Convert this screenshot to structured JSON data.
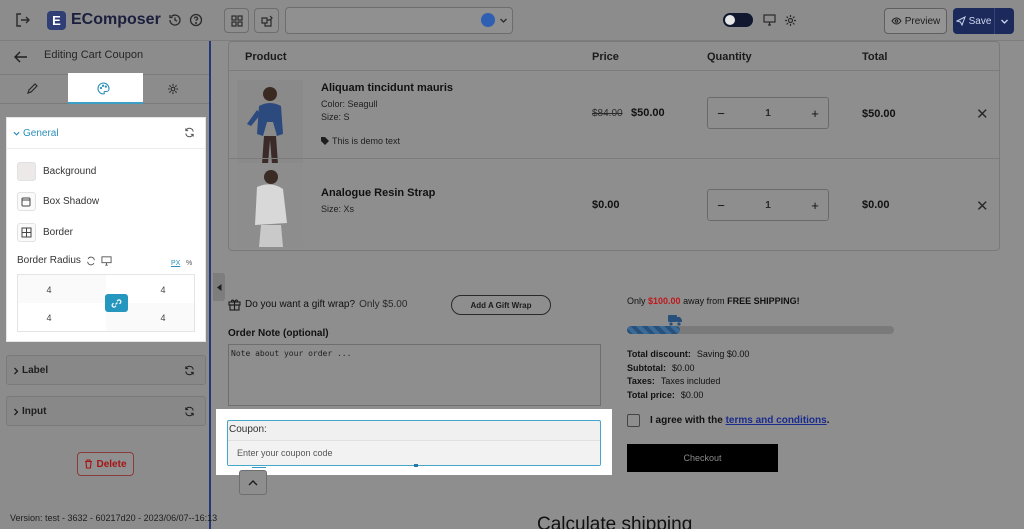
{
  "app": {
    "logo_letter": "E",
    "name": "EComposer"
  },
  "toolbar": {
    "page_selector_value": "",
    "preview_label": "Preview",
    "save_label": "Save"
  },
  "panel": {
    "title": "Editing Cart Coupon",
    "general": {
      "label": "General",
      "properties": [
        "Background",
        "Box Shadow",
        "Border"
      ],
      "border_radius_label": "Border Radius",
      "units": [
        "PX",
        "%"
      ],
      "radius_values": [
        "4",
        "4",
        "4",
        "4"
      ]
    },
    "sections": [
      "Label",
      "Input"
    ],
    "delete_label": "Delete",
    "version": "Version: test - 3632 - 60217d20 - 2023/06/07--16:13"
  },
  "cart": {
    "headers": [
      "Product",
      "Price",
      "Quantity",
      "Total"
    ],
    "items": [
      {
        "name": "Aliquam tincidunt mauris",
        "meta": [
          "Color: Seagull",
          "Size: S"
        ],
        "note": "This is demo text",
        "old_price": "$84.00",
        "price": "$50.00",
        "qty": "1",
        "total": "$50.00"
      },
      {
        "name": "Analogue Resin Strap",
        "meta": [
          "Size: Xs"
        ],
        "note": "",
        "old_price": "",
        "price": "$0.00",
        "qty": "1",
        "total": "$0.00"
      }
    ],
    "qty_minus": "−",
    "qty_plus": "+",
    "remove": "✕"
  },
  "gift": {
    "question": "Do you want a gift wrap?",
    "price": "Only $5.00",
    "button": "Add A Gift Wrap"
  },
  "note": {
    "label": "Order Note (optional)",
    "placeholder": "Note about your order ..."
  },
  "coupon": {
    "label": "Coupon:",
    "placeholder": "Enter your coupon code"
  },
  "shipping": {
    "prefix": "Only",
    "amount": "$100.00",
    "middle": "away from",
    "suffix": "FREE SHIPPING!",
    "progress": 0.2,
    "amount_color": "#c0171a"
  },
  "totals": [
    {
      "label": "Total discount:",
      "value": "Saving $0.00"
    },
    {
      "label": "Subtotal:",
      "value": "$0.00"
    },
    {
      "label": "Taxes:",
      "value": "Taxes included"
    },
    {
      "label": "Total price:",
      "value": "$0.00"
    }
  ],
  "agree": {
    "text": "I agree with the",
    "link": "terms and conditions",
    "end": "."
  },
  "checkout_label": "Checkout",
  "calculate_shipping": "Calculate shipping",
  "colors": {
    "accent": "#2596be",
    "brand": "#2f3e74",
    "save": "#1b2a5b",
    "delete": "#a51414"
  }
}
